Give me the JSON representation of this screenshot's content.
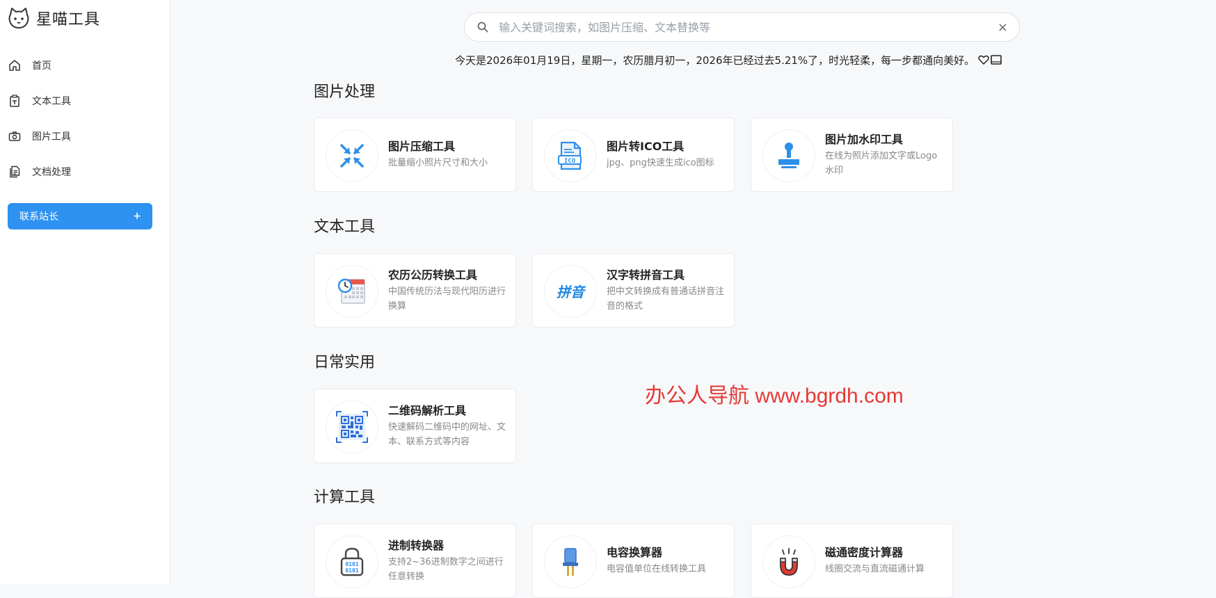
{
  "brand": {
    "name": "星喵工具"
  },
  "nav": [
    {
      "label": "首页",
      "icon": "home-icon"
    },
    {
      "label": "文本工具",
      "icon": "clipboard-icon"
    },
    {
      "label": "图片工具",
      "icon": "camera-icon"
    },
    {
      "label": "文档处理",
      "icon": "document-icon"
    }
  ],
  "contact": {
    "label": "联系站长",
    "plus": "+"
  },
  "search": {
    "placeholder": "输入关键词搜索，如图片压缩、文本替换等",
    "value": "",
    "clear": "×"
  },
  "date_line": "今天是2026年01月19日，星期一，农历腊月初一，2026年已经过去5.21%了，时光轻柔，每一步都通向美好。",
  "sections": [
    {
      "title": "图片处理",
      "cards": [
        {
          "title": "图片压缩工具",
          "desc": "批量缩小照片尺寸和大小",
          "icon": "compress-icon"
        },
        {
          "title": "图片转ICO工具",
          "desc": "jpg、png快速生成ico图标",
          "icon": "ico-file-icon"
        },
        {
          "title": "图片加水印工具",
          "desc": "在线为照片添加文字或Logo水印",
          "icon": "stamp-icon"
        }
      ]
    },
    {
      "title": "文本工具",
      "cards": [
        {
          "title": "农历公历转换工具",
          "desc": "中国传统历法与现代阳历进行换算",
          "icon": "calendar-clock-icon"
        },
        {
          "title": "汉字转拼音工具",
          "desc": "把中文转换成有普通话拼音注音的格式",
          "icon": "pinyin-icon",
          "icon_text": "拼音"
        }
      ]
    },
    {
      "title": "日常实用",
      "cards": [
        {
          "title": "二维码解析工具",
          "desc": "快速解码二维码中的网址、文本、联系方式等内容",
          "icon": "qr-code-icon"
        }
      ]
    },
    {
      "title": "计算工具",
      "cards": [
        {
          "title": "进制转换器",
          "desc": "支持2~36进制数字之间进行任意转换",
          "icon": "binary-lock-icon",
          "icon_text": "0101"
        },
        {
          "title": "电容换算器",
          "desc": "电容值单位在线转换工具",
          "icon": "capacitor-icon"
        },
        {
          "title": "磁通密度计算器",
          "desc": "线圈交流与直流磁通计算",
          "icon": "magnet-icon"
        }
      ]
    }
  ],
  "watermark": "办公人导航  www.bgrdh.com",
  "colors": {
    "accent": "#2d92f0",
    "watermark": "#e53935",
    "background": "#f7f8fa"
  }
}
